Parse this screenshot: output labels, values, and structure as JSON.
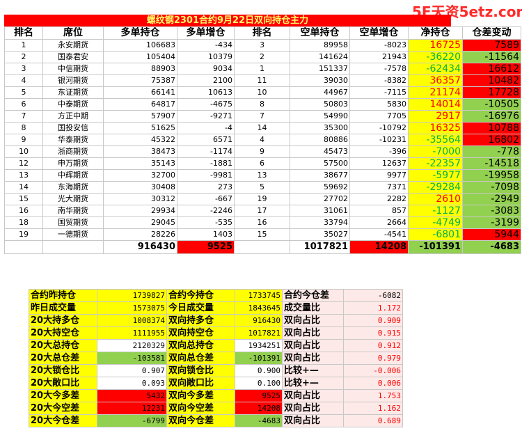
{
  "watermark": "5E天资5etz.com",
  "title": "螺纹钢2301合约9月22日双向持仓主力",
  "headers": [
    "排名",
    "席位",
    "多单持仓",
    "多单增仓",
    "排名",
    "空单持仓",
    "空单增仓",
    "净持仓",
    "仓差变动"
  ],
  "rows": [
    {
      "rank": "1",
      "name": "永安期货",
      "long": "106683",
      "long_chg": "-434",
      "srank": "3",
      "short": "89958",
      "short_chg": "-8023",
      "net": "16725",
      "diff": "7589"
    },
    {
      "rank": "2",
      "name": "国泰君安",
      "long": "105404",
      "long_chg": "10379",
      "srank": "2",
      "short": "141624",
      "short_chg": "21943",
      "net": "-36220",
      "diff": "-11564"
    },
    {
      "rank": "3",
      "name": "中信期货",
      "long": "88903",
      "long_chg": "9034",
      "srank": "1",
      "short": "151337",
      "short_chg": "-7578",
      "net": "-62434",
      "diff": "16612"
    },
    {
      "rank": "4",
      "name": "银河期货",
      "long": "75387",
      "long_chg": "2100",
      "srank": "11",
      "short": "39030",
      "short_chg": "-8382",
      "net": "36357",
      "diff": "10482"
    },
    {
      "rank": "5",
      "name": "东证期货",
      "long": "66141",
      "long_chg": "10613",
      "srank": "10",
      "short": "44967",
      "short_chg": "-7115",
      "net": "21174",
      "diff": "17728"
    },
    {
      "rank": "6",
      "name": "中泰期货",
      "long": "64817",
      "long_chg": "-4675",
      "srank": "8",
      "short": "50803",
      "short_chg": "5830",
      "net": "14014",
      "diff": "-10505"
    },
    {
      "rank": "7",
      "name": "方正中期",
      "long": "57907",
      "long_chg": "-9271",
      "srank": "7",
      "short": "54990",
      "short_chg": "7705",
      "net": "2917",
      "diff": "-16976"
    },
    {
      "rank": "8",
      "name": "国投安信",
      "long": "51625",
      "long_chg": "-4",
      "srank": "14",
      "short": "35300",
      "short_chg": "-10792",
      "net": "16325",
      "diff": "10788"
    },
    {
      "rank": "9",
      "name": "华泰期货",
      "long": "45322",
      "long_chg": "6571",
      "srank": "4",
      "short": "80886",
      "short_chg": "-10231",
      "net": "-35564",
      "diff": "16802"
    },
    {
      "rank": "10",
      "name": "浙商期货",
      "long": "38473",
      "long_chg": "-1174",
      "srank": "9",
      "short": "45473",
      "short_chg": "-396",
      "net": "-7000",
      "diff": "-778"
    },
    {
      "rank": "12",
      "name": "申万期货",
      "long": "35143",
      "long_chg": "-1881",
      "srank": "6",
      "short": "57500",
      "short_chg": "12637",
      "net": "-22357",
      "diff": "-14518"
    },
    {
      "rank": "13",
      "name": "中辉期货",
      "long": "32700",
      "long_chg": "-9981",
      "srank": "13",
      "short": "38677",
      "short_chg": "9977",
      "net": "-5977",
      "diff": "-19958"
    },
    {
      "rank": "14",
      "name": "东海期货",
      "long": "30408",
      "long_chg": "273",
      "srank": "5",
      "short": "59692",
      "short_chg": "7371",
      "net": "-29284",
      "diff": "-7098"
    },
    {
      "rank": "15",
      "name": "光大期货",
      "long": "30312",
      "long_chg": "-667",
      "srank": "19",
      "short": "27702",
      "short_chg": "2282",
      "net": "2610",
      "diff": "-2949"
    },
    {
      "rank": "16",
      "name": "南华期货",
      "long": "29934",
      "long_chg": "-2246",
      "srank": "17",
      "short": "31061",
      "short_chg": "857",
      "net": "-1127",
      "diff": "-3083"
    },
    {
      "rank": "18",
      "name": "国贸期货",
      "long": "29045",
      "long_chg": "-535",
      "srank": "16",
      "short": "33794",
      "short_chg": "2664",
      "net": "-4749",
      "diff": "-3199"
    },
    {
      "rank": "19",
      "name": "一德期货",
      "long": "28226",
      "long_chg": "1403",
      "srank": "15",
      "short": "35027",
      "short_chg": "-4541",
      "net": "-6801",
      "diff": "5944"
    }
  ],
  "total": {
    "long": "916430",
    "long_chg": "9525",
    "short": "1017821",
    "short_chg": "14208",
    "net": "-101391",
    "diff": "-4683"
  },
  "summary": [
    {
      "l1": "合约昨持仓",
      "v1": "1739827",
      "l2": "合约今持仓",
      "v2": "1733745",
      "l3": "合约今仓差",
      "v3": "-6082"
    },
    {
      "l1": "昨日成交量",
      "v1": "1573075",
      "l2": "今日成交量",
      "v2": "1843645",
      "l3": "成交量比",
      "v3": "1.172"
    },
    {
      "l1": "20大持多仓",
      "v1": "1008374",
      "l2": "双向持多仓",
      "v2": "916430",
      "l3": "双向占比",
      "v3": "0.909"
    },
    {
      "l1": "20大持空仓",
      "v1": "1111955",
      "l2": "双向持空仓",
      "v2": "1017821",
      "l3": "双向占比",
      "v3": "0.915"
    },
    {
      "l1": "20大总持仓",
      "v1": "2120329",
      "l2": "双向总持仓",
      "v2": "1934251",
      "l3": "双向占比",
      "v3": "0.912"
    },
    {
      "l1": "20大总仓差",
      "v1": "-103581",
      "l2": "双向总仓差",
      "v2": "-101391",
      "l3": "双向占比",
      "v3": "0.979"
    },
    {
      "l1": "20大锁仓比",
      "v1": "0.907",
      "l2": "双向锁仓比",
      "v2": "0.900",
      "l3": "比较+—",
      "v3": "-0.006"
    },
    {
      "l1": "20大敞口比",
      "v1": "0.093",
      "l2": "双向敞口比",
      "v2": "0.100",
      "l3": "比较+—",
      "v3": "0.006"
    },
    {
      "l1": "20大今多差",
      "v1": "5432",
      "l2": "双向今多差",
      "v2": "9525",
      "l3": "双向占比",
      "v3": "1.753"
    },
    {
      "l1": "20大今空差",
      "v1": "12231",
      "l2": "双向今空差",
      "v2": "14208",
      "l3": "双向占比",
      "v3": "1.162"
    },
    {
      "l1": "20大今仓差",
      "v1": "-6799",
      "l2": "双向今仓差",
      "v2": "-4683",
      "l3": "双向占比",
      "v3": "0.689"
    }
  ],
  "colors": {
    "yellow": "#ffff00",
    "red": "#ff0000",
    "green": "#92d050",
    "pink": "#fde9e7",
    "text_red": "#ff0000",
    "text_green": "#00b050"
  }
}
